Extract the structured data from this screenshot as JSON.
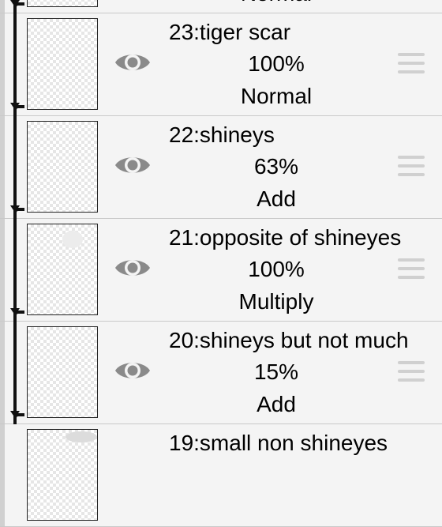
{
  "layers": [
    {
      "id": "top-partial",
      "name": "",
      "opacity": "",
      "blend": "Normal",
      "visible": true,
      "clipped": true
    },
    {
      "id": "23",
      "name": "23:tiger scar",
      "opacity": "100%",
      "blend": "Normal",
      "visible": true,
      "clipped": true
    },
    {
      "id": "22",
      "name": "22:shineys",
      "opacity": "63%",
      "blend": "Add",
      "visible": true,
      "clipped": true
    },
    {
      "id": "21",
      "name": "21:opposite of shineyes",
      "opacity": "100%",
      "blend": "Multiply",
      "visible": true,
      "clipped": true
    },
    {
      "id": "20",
      "name": "20:shineys but not much",
      "opacity": "15%",
      "blend": "Add",
      "visible": true,
      "clipped": true
    },
    {
      "id": "19",
      "name": "19:small non shineyes",
      "opacity": "",
      "blend": "",
      "visible": true,
      "clipped": false
    }
  ],
  "icons": {
    "visibility": "eye-icon",
    "reorder": "drag-handle-icon"
  },
  "colors": {
    "icon_gray": "#8a8a8a",
    "clip_black": "#111111",
    "handle_gray": "#d0d0d0"
  }
}
